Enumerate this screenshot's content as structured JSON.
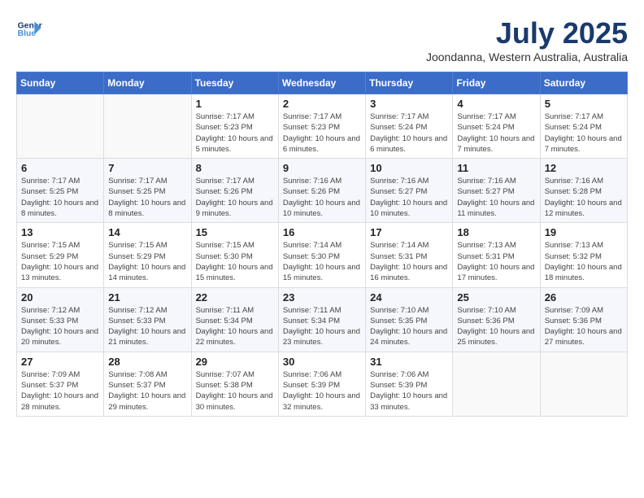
{
  "header": {
    "logo_line1": "General",
    "logo_line2": "Blue",
    "title": "July 2025",
    "subtitle": "Joondanna, Western Australia, Australia"
  },
  "calendar": {
    "days_of_week": [
      "Sunday",
      "Monday",
      "Tuesday",
      "Wednesday",
      "Thursday",
      "Friday",
      "Saturday"
    ],
    "weeks": [
      [
        {
          "day": "",
          "info": ""
        },
        {
          "day": "",
          "info": ""
        },
        {
          "day": "1",
          "info": "Sunrise: 7:17 AM\nSunset: 5:23 PM\nDaylight: 10 hours and 5 minutes."
        },
        {
          "day": "2",
          "info": "Sunrise: 7:17 AM\nSunset: 5:23 PM\nDaylight: 10 hours and 6 minutes."
        },
        {
          "day": "3",
          "info": "Sunrise: 7:17 AM\nSunset: 5:24 PM\nDaylight: 10 hours and 6 minutes."
        },
        {
          "day": "4",
          "info": "Sunrise: 7:17 AM\nSunset: 5:24 PM\nDaylight: 10 hours and 7 minutes."
        },
        {
          "day": "5",
          "info": "Sunrise: 7:17 AM\nSunset: 5:24 PM\nDaylight: 10 hours and 7 minutes."
        }
      ],
      [
        {
          "day": "6",
          "info": "Sunrise: 7:17 AM\nSunset: 5:25 PM\nDaylight: 10 hours and 8 minutes."
        },
        {
          "day": "7",
          "info": "Sunrise: 7:17 AM\nSunset: 5:25 PM\nDaylight: 10 hours and 8 minutes."
        },
        {
          "day": "8",
          "info": "Sunrise: 7:17 AM\nSunset: 5:26 PM\nDaylight: 10 hours and 9 minutes."
        },
        {
          "day": "9",
          "info": "Sunrise: 7:16 AM\nSunset: 5:26 PM\nDaylight: 10 hours and 10 minutes."
        },
        {
          "day": "10",
          "info": "Sunrise: 7:16 AM\nSunset: 5:27 PM\nDaylight: 10 hours and 10 minutes."
        },
        {
          "day": "11",
          "info": "Sunrise: 7:16 AM\nSunset: 5:27 PM\nDaylight: 10 hours and 11 minutes."
        },
        {
          "day": "12",
          "info": "Sunrise: 7:16 AM\nSunset: 5:28 PM\nDaylight: 10 hours and 12 minutes."
        }
      ],
      [
        {
          "day": "13",
          "info": "Sunrise: 7:15 AM\nSunset: 5:29 PM\nDaylight: 10 hours and 13 minutes."
        },
        {
          "day": "14",
          "info": "Sunrise: 7:15 AM\nSunset: 5:29 PM\nDaylight: 10 hours and 14 minutes."
        },
        {
          "day": "15",
          "info": "Sunrise: 7:15 AM\nSunset: 5:30 PM\nDaylight: 10 hours and 15 minutes."
        },
        {
          "day": "16",
          "info": "Sunrise: 7:14 AM\nSunset: 5:30 PM\nDaylight: 10 hours and 15 minutes."
        },
        {
          "day": "17",
          "info": "Sunrise: 7:14 AM\nSunset: 5:31 PM\nDaylight: 10 hours and 16 minutes."
        },
        {
          "day": "18",
          "info": "Sunrise: 7:13 AM\nSunset: 5:31 PM\nDaylight: 10 hours and 17 minutes."
        },
        {
          "day": "19",
          "info": "Sunrise: 7:13 AM\nSunset: 5:32 PM\nDaylight: 10 hours and 18 minutes."
        }
      ],
      [
        {
          "day": "20",
          "info": "Sunrise: 7:12 AM\nSunset: 5:33 PM\nDaylight: 10 hours and 20 minutes."
        },
        {
          "day": "21",
          "info": "Sunrise: 7:12 AM\nSunset: 5:33 PM\nDaylight: 10 hours and 21 minutes."
        },
        {
          "day": "22",
          "info": "Sunrise: 7:11 AM\nSunset: 5:34 PM\nDaylight: 10 hours and 22 minutes."
        },
        {
          "day": "23",
          "info": "Sunrise: 7:11 AM\nSunset: 5:34 PM\nDaylight: 10 hours and 23 minutes."
        },
        {
          "day": "24",
          "info": "Sunrise: 7:10 AM\nSunset: 5:35 PM\nDaylight: 10 hours and 24 minutes."
        },
        {
          "day": "25",
          "info": "Sunrise: 7:10 AM\nSunset: 5:36 PM\nDaylight: 10 hours and 25 minutes."
        },
        {
          "day": "26",
          "info": "Sunrise: 7:09 AM\nSunset: 5:36 PM\nDaylight: 10 hours and 27 minutes."
        }
      ],
      [
        {
          "day": "27",
          "info": "Sunrise: 7:09 AM\nSunset: 5:37 PM\nDaylight: 10 hours and 28 minutes."
        },
        {
          "day": "28",
          "info": "Sunrise: 7:08 AM\nSunset: 5:37 PM\nDaylight: 10 hours and 29 minutes."
        },
        {
          "day": "29",
          "info": "Sunrise: 7:07 AM\nSunset: 5:38 PM\nDaylight: 10 hours and 30 minutes."
        },
        {
          "day": "30",
          "info": "Sunrise: 7:06 AM\nSunset: 5:39 PM\nDaylight: 10 hours and 32 minutes."
        },
        {
          "day": "31",
          "info": "Sunrise: 7:06 AM\nSunset: 5:39 PM\nDaylight: 10 hours and 33 minutes."
        },
        {
          "day": "",
          "info": ""
        },
        {
          "day": "",
          "info": ""
        }
      ]
    ]
  }
}
